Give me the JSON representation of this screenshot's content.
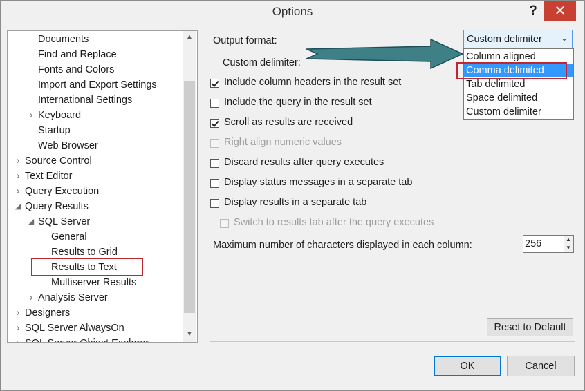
{
  "window": {
    "title": "Options",
    "help_label": "?",
    "close_label": "✕"
  },
  "tree": {
    "items": [
      {
        "label": "Documents",
        "indent": 2,
        "arrow": ""
      },
      {
        "label": "Find and Replace",
        "indent": 2,
        "arrow": ""
      },
      {
        "label": "Fonts and Colors",
        "indent": 2,
        "arrow": ""
      },
      {
        "label": "Import and Export Settings",
        "indent": 2,
        "arrow": ""
      },
      {
        "label": "International Settings",
        "indent": 2,
        "arrow": ""
      },
      {
        "label": "Keyboard",
        "indent": 2,
        "arrow": "collapsed"
      },
      {
        "label": "Startup",
        "indent": 2,
        "arrow": ""
      },
      {
        "label": "Web Browser",
        "indent": 2,
        "arrow": ""
      },
      {
        "label": "Source Control",
        "indent": 1,
        "arrow": "collapsed"
      },
      {
        "label": "Text Editor",
        "indent": 1,
        "arrow": "collapsed"
      },
      {
        "label": "Query Execution",
        "indent": 1,
        "arrow": "collapsed"
      },
      {
        "label": "Query Results",
        "indent": 1,
        "arrow": "expanded"
      },
      {
        "label": "SQL Server",
        "indent": 2,
        "arrow": "expanded"
      },
      {
        "label": "General",
        "indent": 3,
        "arrow": ""
      },
      {
        "label": "Results to Grid",
        "indent": 3,
        "arrow": ""
      },
      {
        "label": "Results to Text",
        "indent": 3,
        "arrow": ""
      },
      {
        "label": "Multiserver Results",
        "indent": 3,
        "arrow": ""
      },
      {
        "label": "Analysis Server",
        "indent": 2,
        "arrow": "collapsed"
      },
      {
        "label": "Designers",
        "indent": 1,
        "arrow": "collapsed"
      },
      {
        "label": "SQL Server AlwaysOn",
        "indent": 1,
        "arrow": "collapsed"
      },
      {
        "label": "SQL Server Object Explorer",
        "indent": 1,
        "arrow": "collapsed"
      }
    ]
  },
  "settings": {
    "output_format_label": "Output format:",
    "custom_delimiter_label": "Custom delimiter:",
    "output_format_value": "Custom delimiter",
    "output_format_options": [
      "Column aligned",
      "Comma delimited",
      "Tab delimited",
      "Space delimited",
      "Custom delimiter"
    ],
    "highlighted_option": "Comma delimited",
    "checkboxes": [
      {
        "label": "Include column headers in the result set",
        "checked": true,
        "disabled": false
      },
      {
        "label": "Include the query in the result set",
        "checked": false,
        "disabled": false
      },
      {
        "label": "Scroll as results are received",
        "checked": true,
        "disabled": false
      },
      {
        "label": "Right align numeric values",
        "checked": false,
        "disabled": true
      },
      {
        "label": "Discard results after query executes",
        "checked": false,
        "disabled": false
      },
      {
        "label": "Display status messages in a separate tab",
        "checked": false,
        "disabled": false
      },
      {
        "label": "Display results in a separate tab",
        "checked": false,
        "disabled": false
      },
      {
        "label": "Switch to results tab after the query executes",
        "checked": false,
        "disabled": true
      }
    ],
    "max_chars_label": "Maximum number of characters displayed in each column:",
    "max_chars_value": "256",
    "reset_label": "Reset to Default"
  },
  "footer": {
    "ok_label": "OK",
    "cancel_label": "Cancel"
  },
  "colors": {
    "accent": "#0078d7",
    "highlight_red": "#c0262f",
    "arrow_teal": "#3f7f86",
    "selection_blue": "#3399ff"
  }
}
